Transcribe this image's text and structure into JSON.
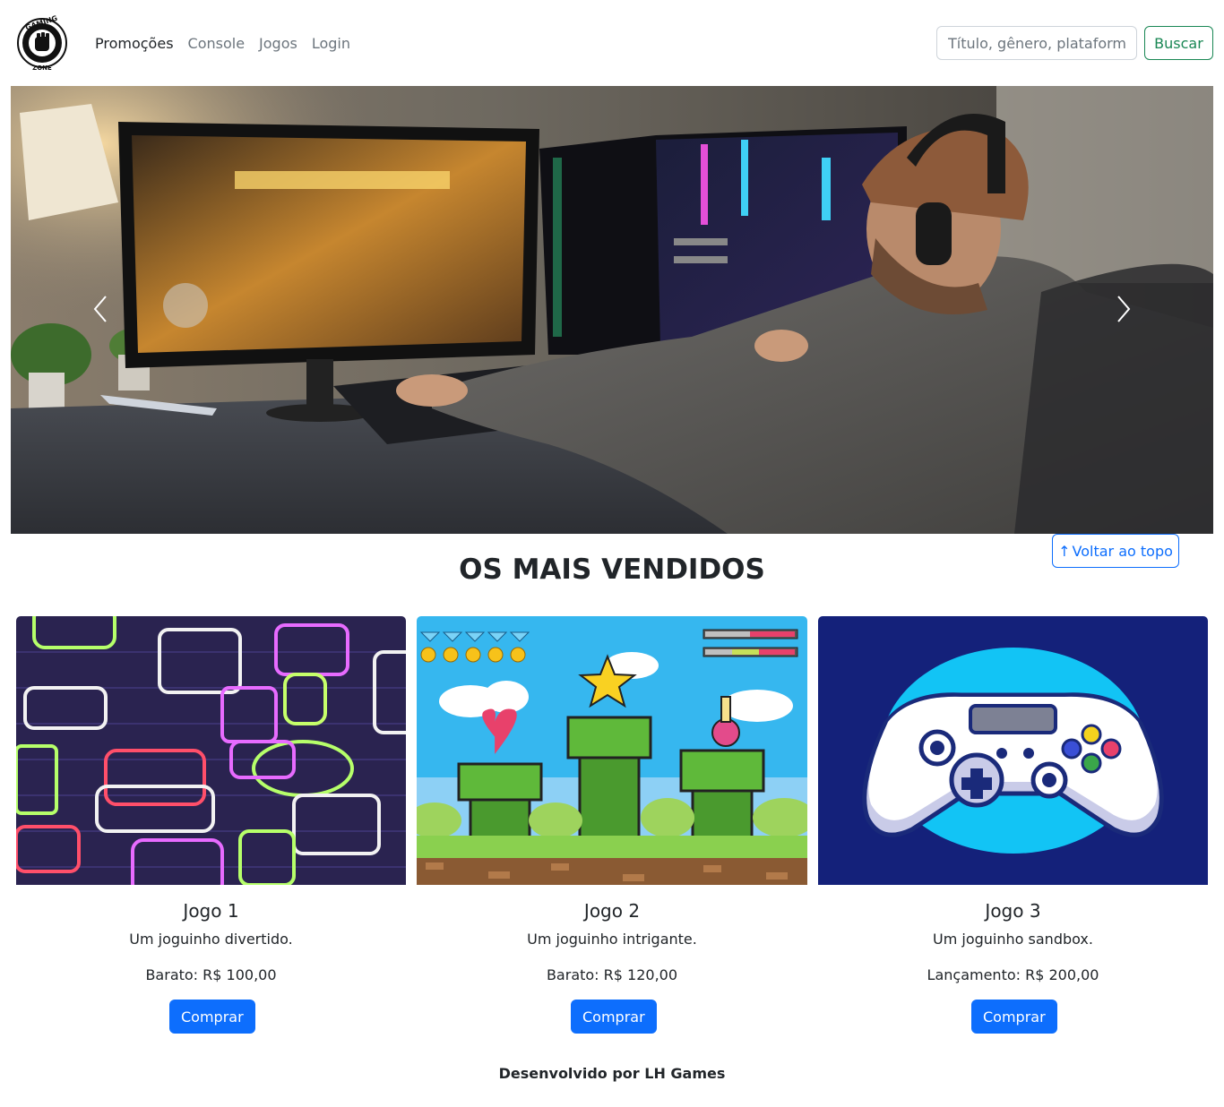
{
  "header": {
    "logo_alt": "Gaming Zone",
    "logo_text_top": "GAMING",
    "logo_text_bottom": "ZONE",
    "nav": [
      {
        "label": "Promoções",
        "active": true
      },
      {
        "label": "Console",
        "active": false
      },
      {
        "label": "Jogos",
        "active": false
      },
      {
        "label": "Login",
        "active": false
      }
    ],
    "search": {
      "placeholder": "Título, gênero, plataforma",
      "value": ""
    },
    "search_button": "Buscar"
  },
  "carousel": {
    "prev_icon": "chevron-left-icon",
    "next_icon": "chevron-right-icon"
  },
  "main": {
    "section_title": "OS MAIS VENDIDOS",
    "back_to_top_label": "Voltar ao topo",
    "back_to_top_icon": "↑",
    "cards": [
      {
        "title": "Jogo 1",
        "description": "Um joguinho divertido.",
        "price": "Barato: R$ 100,00",
        "button": "Comprar"
      },
      {
        "title": "Jogo 2",
        "description": "Um joguinho intrigante.",
        "price": "Barato: R$ 120,00",
        "button": "Comprar"
      },
      {
        "title": "Jogo 3",
        "description": "Um joguinho sandbox.",
        "price": "Lançamento: R$ 200,00",
        "button": "Comprar"
      }
    ]
  },
  "footer": {
    "text": "Desenvolvido por LH Games"
  },
  "colors": {
    "primary": "#0d6efd",
    "success": "#198754",
    "text": "#212529",
    "muted": "#6c757d"
  }
}
